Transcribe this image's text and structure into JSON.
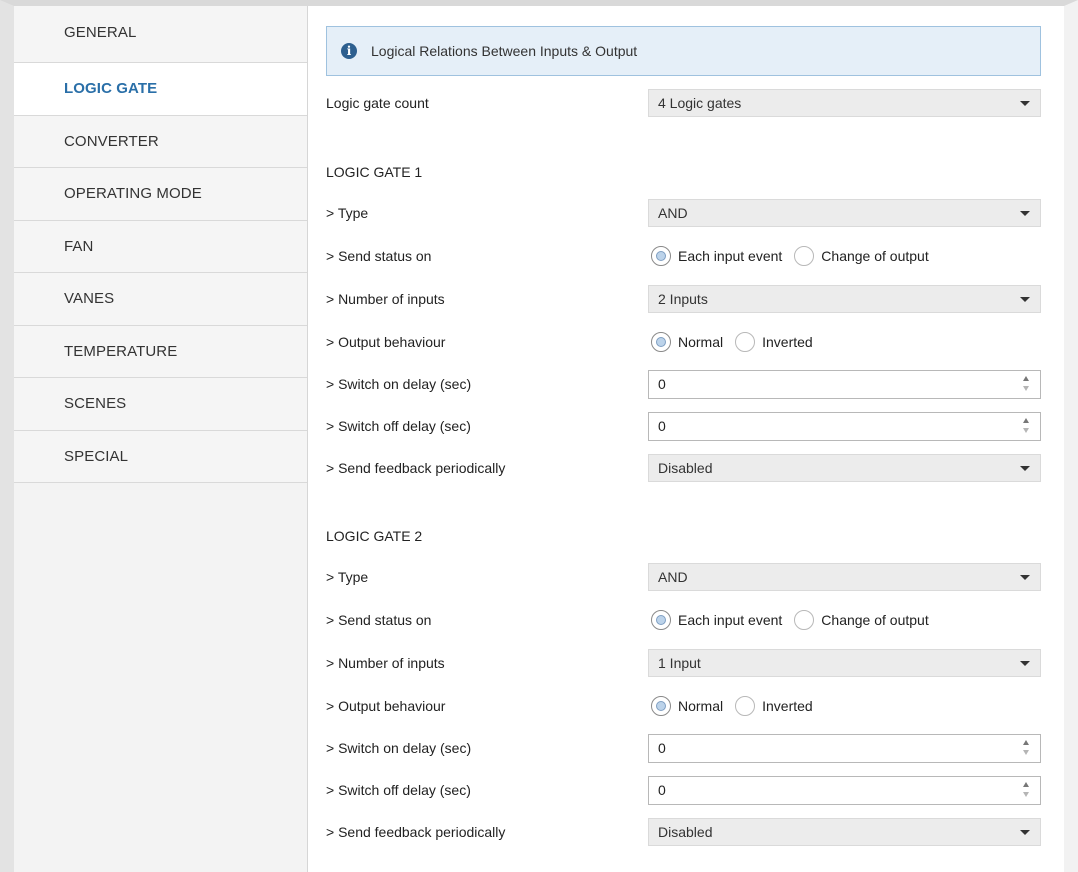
{
  "sidebar": {
    "items": [
      {
        "label": "GENERAL"
      },
      {
        "label": "LOGIC GATE"
      },
      {
        "label": "CONVERTER"
      },
      {
        "label": "OPERATING MODE"
      },
      {
        "label": "FAN"
      },
      {
        "label": "VANES"
      },
      {
        "label": "TEMPERATURE"
      },
      {
        "label": "SCENES"
      },
      {
        "label": "SPECIAL"
      }
    ],
    "active": "LOGIC GATE"
  },
  "info": {
    "icon": "info-icon",
    "text": "Logical Relations Between Inputs & Output"
  },
  "gate_count": {
    "label": "Logic gate count",
    "value": "4 Logic gates"
  },
  "gates": [
    {
      "title": "LOGIC GATE 1",
      "type": {
        "label": "> Type",
        "value": "AND"
      },
      "send_status": {
        "label": "> Send status on",
        "option1": "Each input event",
        "option2": "Change of output",
        "selected": "Each input event"
      },
      "inputs": {
        "label": "> Number of inputs",
        "value": "2 Inputs"
      },
      "output": {
        "label": "> Output behaviour",
        "option1": "Normal",
        "option2": "Inverted",
        "selected": "Normal"
      },
      "on_delay": {
        "label": "> Switch on delay (sec)",
        "value": "0"
      },
      "off_delay": {
        "label": "> Switch off delay (sec)",
        "value": "0"
      },
      "feedback": {
        "label": "> Send feedback periodically",
        "value": "Disabled"
      }
    },
    {
      "title": "LOGIC GATE 2",
      "type": {
        "label": "> Type",
        "value": "AND"
      },
      "send_status": {
        "label": "> Send status on",
        "option1": "Each input event",
        "option2": "Change of output",
        "selected": "Each input event"
      },
      "inputs": {
        "label": "> Number of inputs",
        "value": "1 Input"
      },
      "output": {
        "label": "> Output behaviour",
        "option1": "Normal",
        "option2": "Inverted",
        "selected": "Normal"
      },
      "on_delay": {
        "label": "> Switch on delay (sec)",
        "value": "0"
      },
      "off_delay": {
        "label": "> Switch off delay (sec)",
        "value": "0"
      },
      "feedback": {
        "label": "> Send feedback periodically",
        "value": "Disabled"
      }
    }
  ],
  "colors": {
    "active_nav": "#2a6fa8",
    "info_bg": "#e5eff8",
    "info_border": "#9fc2df",
    "select_bg": "#ececec"
  }
}
